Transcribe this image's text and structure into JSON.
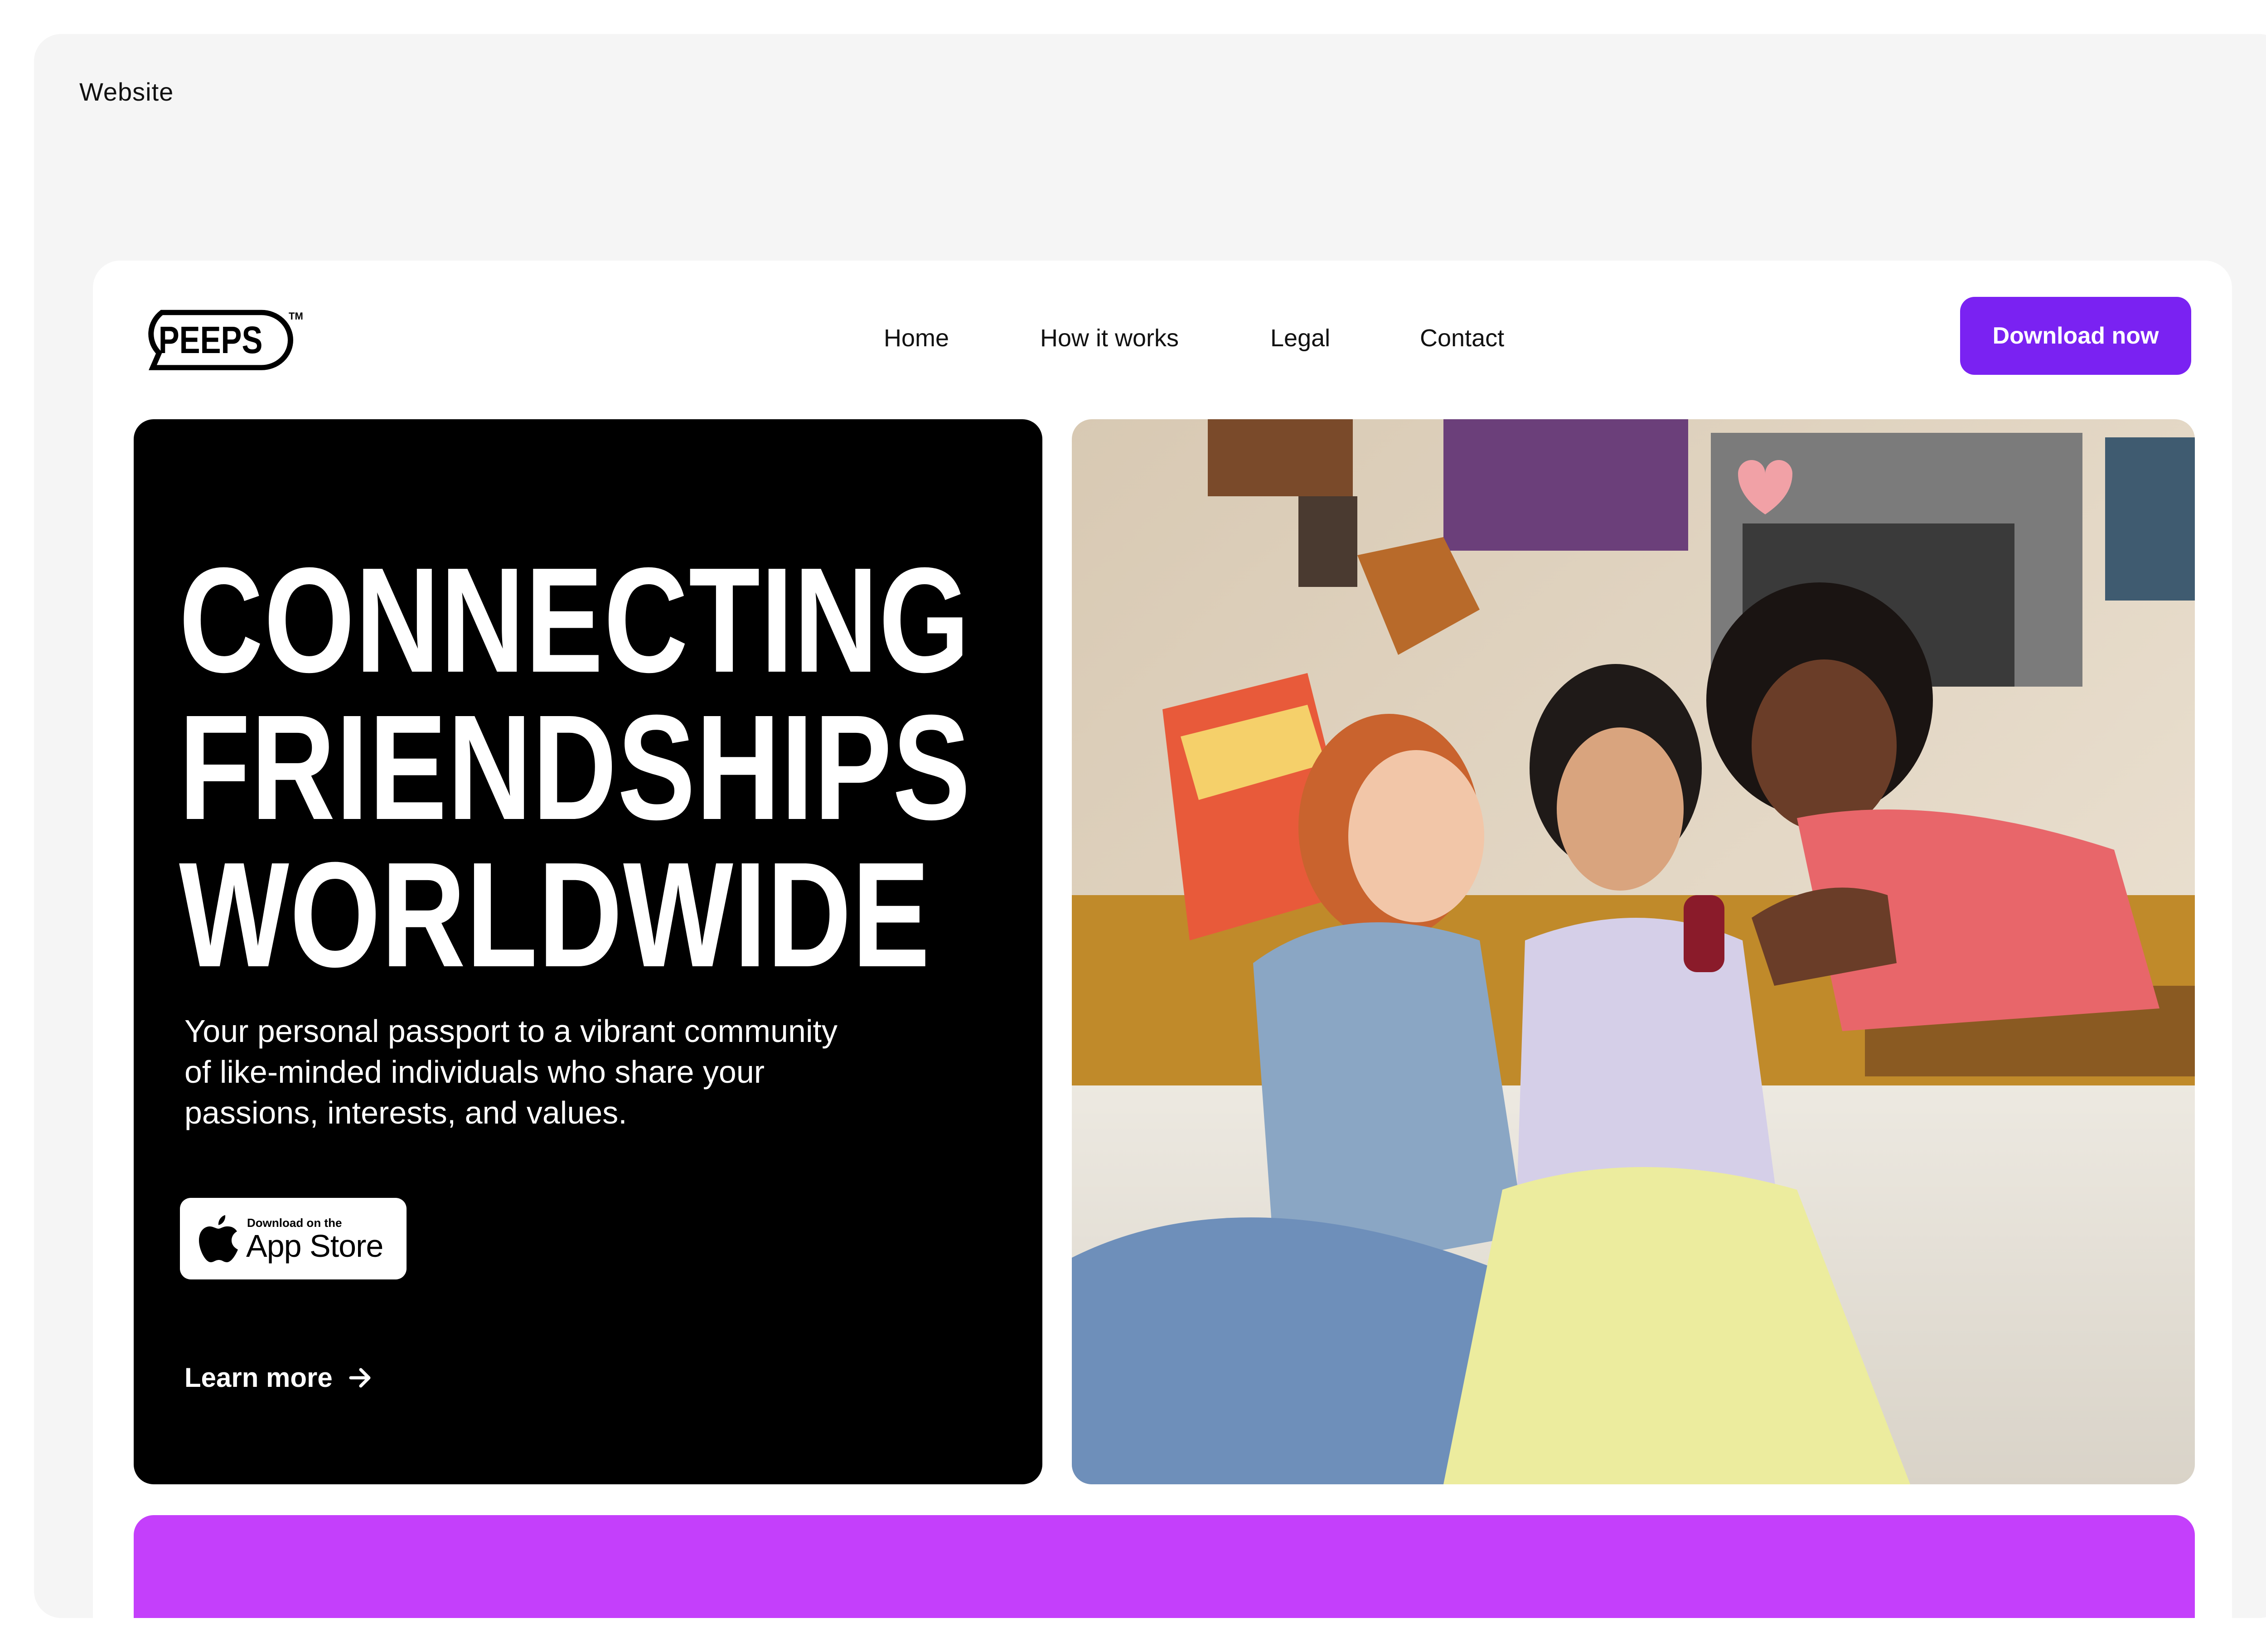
{
  "frame": {
    "label": "Website"
  },
  "header": {
    "logo_text": "PEEPS",
    "logo_tm": "TM",
    "nav": [
      {
        "label": "Home"
      },
      {
        "label": "How it works"
      },
      {
        "label": "Legal"
      },
      {
        "label": "Contact"
      }
    ],
    "cta_label": "Download now"
  },
  "hero": {
    "headline": [
      "CONNECTING",
      "FRIENDSHIPS",
      "WORLDWIDE"
    ],
    "subtitle": "Your personal passport to a vibrant community of like-minded individuals who share your passions, interests, and values.",
    "appstore": {
      "small": "Download on the",
      "big": "App Store"
    },
    "learn_more": "Learn more",
    "photo": {
      "subject": "three friends looking at a phone together"
    }
  },
  "colors": {
    "accent": "#7a22f2",
    "band": "#c43ffb",
    "hero_bg": "#000000",
    "frame_bg": "#f5f5f5"
  },
  "icons": [
    "speech-bubble-logo",
    "apple-icon",
    "arrow-right-icon"
  ]
}
